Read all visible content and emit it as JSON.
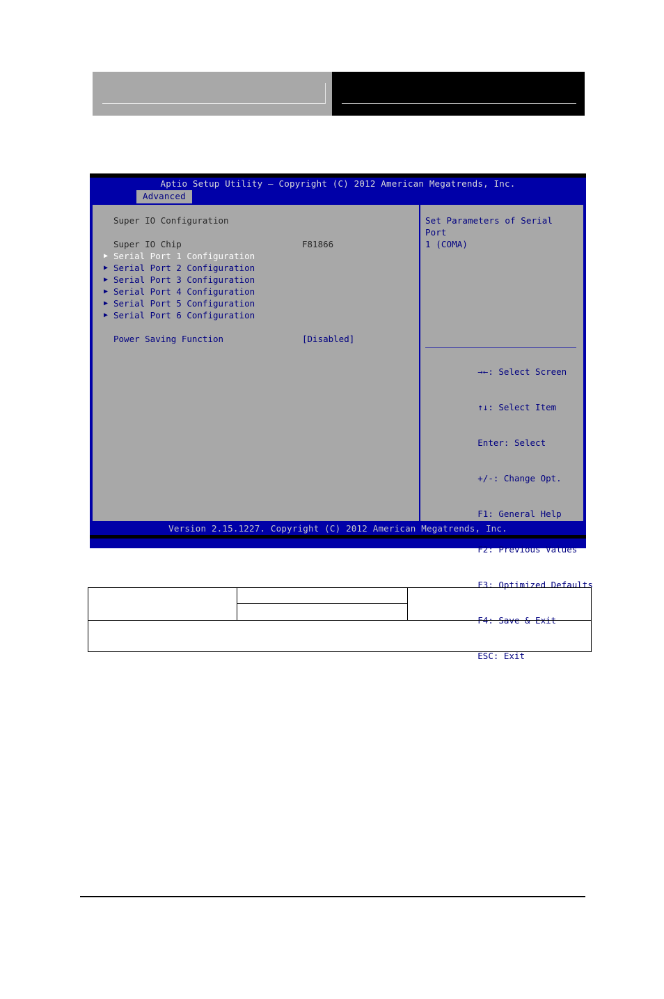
{
  "bios": {
    "title": "Aptio Setup Utility – Copyright (C) 2012 American Megatrends, Inc.",
    "tab": "Advanced",
    "section_heading": "Super IO Configuration",
    "chip": {
      "label": "Super IO Chip",
      "value": "F81866"
    },
    "menu_items": [
      {
        "arrow": "▶",
        "label": "Serial Port 1 Configuration",
        "selected": true
      },
      {
        "arrow": "▶",
        "label": "Serial Port 2 Configuration",
        "selected": false
      },
      {
        "arrow": "▶",
        "label": "Serial Port 3 Configuration",
        "selected": false
      },
      {
        "arrow": "▶",
        "label": "Serial Port 4 Configuration",
        "selected": false
      },
      {
        "arrow": "▶",
        "label": "Serial Port 5 Configuration",
        "selected": false
      },
      {
        "arrow": "▶",
        "label": "Serial Port 6 Configuration",
        "selected": false
      }
    ],
    "power_saving": {
      "label": "Power Saving Function",
      "value": "[Disabled]"
    },
    "help": {
      "text": "Set Parameters of Serial Port\n1 (COMA)"
    },
    "keys": [
      {
        "key": "→←",
        "desc": ": Select Screen"
      },
      {
        "key": "↑↓",
        "desc": ": Select Item"
      },
      {
        "key": "Enter",
        "desc": ": Select"
      },
      {
        "key": "+/-",
        "desc": ": Change Opt."
      },
      {
        "key": "F1",
        "desc": ": General Help"
      },
      {
        "key": "F2",
        "desc": ": Previous Values"
      },
      {
        "key": "F3",
        "desc": ": Optimized Defaults"
      },
      {
        "key": "F4",
        "desc": ": Save & Exit"
      },
      {
        "key": "ESC",
        "desc": ": Exit"
      }
    ],
    "footer": "Version 2.15.1227. Copyright (C) 2012 American Megatrends, Inc.",
    "colors": {
      "window_blue": "#0000a8",
      "panel_gray": "#a8a8a8",
      "text_blue": "#000080",
      "text_selected": "#ffffff",
      "text_dark": "#282828"
    }
  }
}
